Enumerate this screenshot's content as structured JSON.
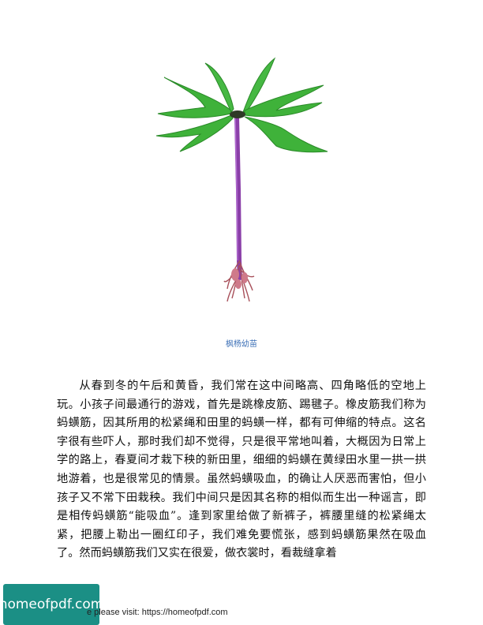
{
  "figure": {
    "caption": "枫杨幼苗",
    "colors": {
      "leaf": "#3fb23a",
      "leaf_dark": "#2a8a28",
      "stem": "#8a3fa8",
      "root": "#a8505a"
    }
  },
  "body": {
    "paragraph": "从春到冬的午后和黄昏，我们常在这中间略高、四角略低的空地上玩。小孩子间最通行的游戏，首先是跳橡皮筋、踢毽子。橡皮筋我们称为蚂蟥筋，因其所用的松紧绳和田里的蚂蟥一样，都有可伸缩的特点。这名字很有些吓人，那时我们却不觉得，只是很平常地叫着，大概因为日常上学的路上，春夏间才栽下秧的新田里，细细的蚂蟥在黄绿田水里一拱一拱地游着，也是很常见的情景。虽然蚂蟥吸血，的确让人厌恶而害怕，但小孩子又不常下田栽秧。我们中间只是因其名称的相似而生出一种谣言，即是相传蚂蟥筋“能吸血”。逢到家里给做了新裤子，裤腰里缝的松紧绳太紧，把腰上勒出一圈红印子，我们难免要慌张，感到蚂蟥筋果然在吸血了。然而蚂蟥筋我们又实在很爱，做衣裳时，看裁缝拿着"
  },
  "footer": {
    "logo_text": "homeofpdf.com",
    "visit_text": "e please visit: https://homeofpdf.com"
  }
}
